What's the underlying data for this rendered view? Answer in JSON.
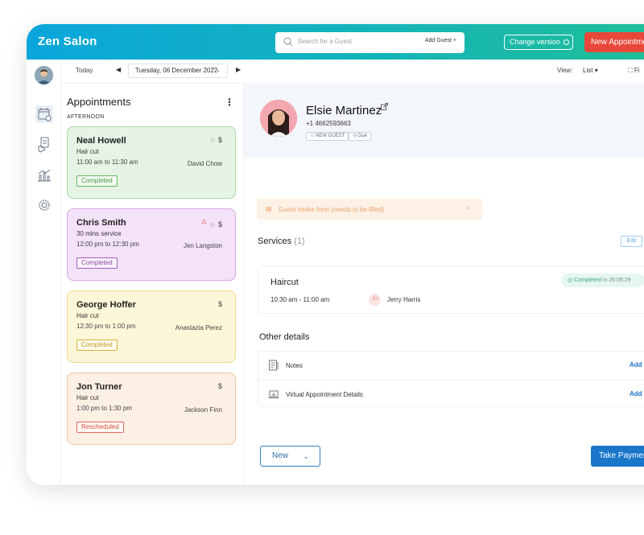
{
  "app": {
    "title": "Zen Salon",
    "search_placeholder": "Search for a Guest",
    "add_guest": "Add Guest",
    "change_version": "Change version",
    "new_appointment": "New Appointment"
  },
  "toolbar": {
    "today": "Today",
    "date": "Tuesday, 06 December 2022",
    "view_label": "View:",
    "view_value": "List",
    "filter": "Fi"
  },
  "appointments": {
    "title": "Appointments",
    "section": "AFTERNOON",
    "items": [
      {
        "name": "Neal Howell",
        "service": "Hair cut",
        "time": "11:00 am to 11:30 am",
        "staff": "David Chow",
        "status": "Completed",
        "price": "$"
      },
      {
        "name": "Chris Smith",
        "service": "30 mins service",
        "time": "12:00 pm to 12:30 pm",
        "staff": "Jen Langston",
        "status": "Completed",
        "price": "$"
      },
      {
        "name": "George Hoffer",
        "service": "Hair cut",
        "time": "12:30 pm to 1:00 pm",
        "staff": "Anastazia Perez",
        "status": "Completed",
        "price": "$"
      },
      {
        "name": "Jon Turner",
        "service": "Hair cut",
        "time": "1:00 pm to 1:30 pm",
        "staff": "Jackson Finn",
        "status": "Rescheduled",
        "price": "$"
      }
    ]
  },
  "client": {
    "name": "Elsie Martinez",
    "phone": "+1 4662593663",
    "tags": [
      "NEW GUEST",
      "Due"
    ]
  },
  "intake": {
    "text": "Guest intake form (needs to be filled)"
  },
  "services": {
    "title": "Services",
    "count": "(1)",
    "edit": "Edit",
    "item": {
      "name": "Haircut",
      "time": "10:30 am - 11:00 am",
      "staff_initials": "JH",
      "staff": "Jerry Harris",
      "status": "Completed",
      "status_time": "in 26:05:29"
    }
  },
  "other": {
    "title": "Other details",
    "rows": [
      {
        "label": "Notes",
        "action": "Add"
      },
      {
        "label": "Virtual Appointment Details",
        "action": "Add"
      }
    ]
  },
  "footer": {
    "new": "New",
    "take_payment": "Take Payment"
  }
}
